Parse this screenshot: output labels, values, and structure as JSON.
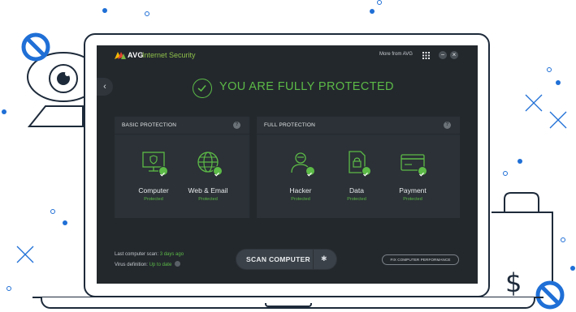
{
  "app": {
    "brand": "AVG",
    "product": "Internet Security",
    "more_link": "More from AVG",
    "minimize": "−",
    "close": "×",
    "back": "‹"
  },
  "status": {
    "headline": "YOU ARE FULLY PROTECTED"
  },
  "basic_protection": {
    "title": "BASIC PROTECTION",
    "help": "?",
    "tiles": [
      {
        "name": "Computer",
        "status": "Protected",
        "icon": "monitor-shield-icon"
      },
      {
        "name": "Web & Email",
        "status": "Protected",
        "icon": "globe-icon"
      }
    ]
  },
  "full_protection": {
    "title": "FULL PROTECTION",
    "help": "?",
    "tiles": [
      {
        "name": "Hacker",
        "status": "Protected",
        "icon": "hacker-icon"
      },
      {
        "name": "Data",
        "status": "Protected",
        "icon": "lock-file-icon"
      },
      {
        "name": "Payment",
        "status": "Protected",
        "icon": "credit-card-icon"
      }
    ]
  },
  "footer": {
    "last_scan_label": "Last computer scan:",
    "last_scan_value": "3 days ago",
    "virus_def_label": "Virus definition:",
    "virus_def_value": "Up to date",
    "scan_button": "SCAN COMPUTER",
    "fix_button": "FIX COMPUTER PERFORMANCE"
  },
  "colors": {
    "accent_green": "#5cba47",
    "brand_green": "#8fc04a",
    "ui_dark": "#23282d",
    "illustration_blue": "#1f6fd6",
    "outline": "#1d2a3a"
  }
}
